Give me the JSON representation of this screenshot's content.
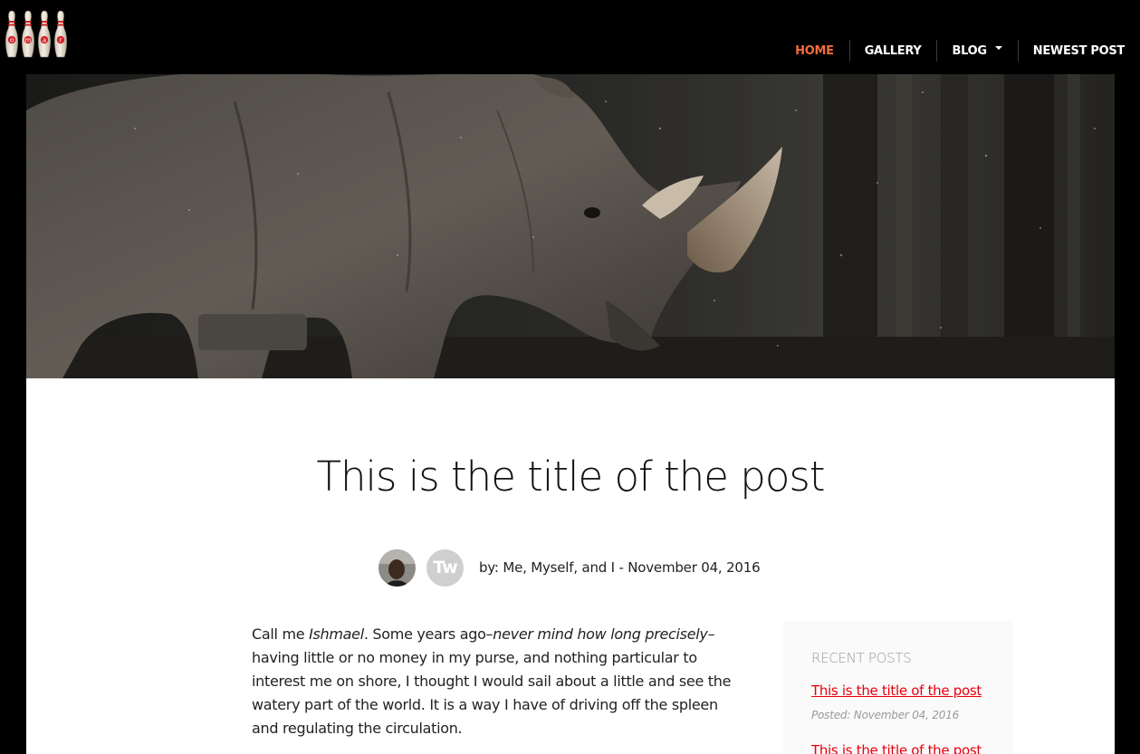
{
  "nav": {
    "items": [
      {
        "label": "HOME",
        "active": true
      },
      {
        "label": "GALLERY",
        "active": false
      },
      {
        "label": "BLOG",
        "active": false,
        "dropdown": true
      },
      {
        "label": "NEWEST POST",
        "active": false
      }
    ]
  },
  "logo": {
    "icon": "bowling-pins-icon",
    "letters": [
      "o",
      "m",
      "a",
      "r"
    ]
  },
  "post": {
    "title": "This is the title of the post",
    "author_badge": "Tw",
    "byline": "by: Me, Myself, and I - November 04, 2016",
    "body": {
      "p1": "Call me ",
      "em1": "Ishmael",
      "p2": ". Some years ago–",
      "em2": "never mind how long precisely",
      "p3": "–having little or no money in my purse, and nothing particular to interest me on shore, I thought I would sail about a little and see the watery part of the world. It is a way I have of driving off the spleen and regulating the circulation."
    }
  },
  "sidebar": {
    "heading": "RECENT POSTS",
    "posts": [
      {
        "title": "This is the title of the post",
        "date": "Posted: November 04, 2016"
      },
      {
        "title": "This is the title of the post"
      }
    ]
  },
  "colors": {
    "accent_nav": "#f26b3a",
    "link": "#e8000d",
    "background": "#000000"
  }
}
